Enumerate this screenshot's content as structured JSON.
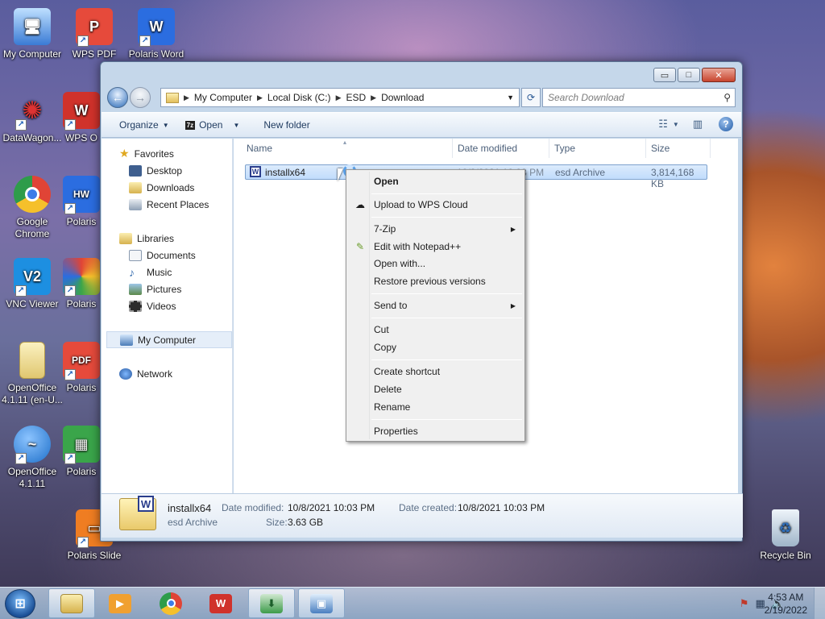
{
  "desktop_icons": [
    {
      "label": "My Computer",
      "icon": "computer-icon",
      "color": "#3a7bd5"
    },
    {
      "label": "WPS PDF",
      "icon": "wps-pdf-icon",
      "color": "#e64a3b"
    },
    {
      "label": "Polaris Word",
      "icon": "polaris-word-icon",
      "color": "#2b6de0"
    },
    {
      "label": "DataWagon...",
      "icon": "datawagon-icon",
      "color": "#c9382e"
    },
    {
      "label": "WPS O",
      "icon": "wps-office-icon",
      "color": "#d0322b"
    },
    {
      "label": "Google Chrome",
      "icon": "chrome-icon",
      "color": "#2e9c4a"
    },
    {
      "label": "Polaris",
      "icon": "polaris-hw-icon",
      "color": "#2b6de0"
    },
    {
      "label": "VNC Viewer",
      "icon": "vnc-icon",
      "color": "#1d8fe1"
    },
    {
      "label": "Polaris",
      "icon": "polaris-icon",
      "color": "#e48b24"
    },
    {
      "label": "OpenOffice 4.1.11 (en-U...",
      "icon": "openoffice-folder-icon",
      "color": "#e8d482"
    },
    {
      "label": "Polaris",
      "icon": "polaris-pdf-icon",
      "color": "#e64a3b"
    },
    {
      "label": "OpenOffice 4.1.11",
      "icon": "openoffice-icon",
      "color": "#1e6fc9"
    },
    {
      "label": "Polaris",
      "icon": "polaris-sheet-icon",
      "color": "#3aa54a"
    },
    {
      "label": "Polaris Slide",
      "icon": "polaris-slide-icon",
      "color": "#ef7d22"
    },
    {
      "label": "Recycle Bin",
      "icon": "recycle-bin-icon",
      "color": "#9fb5c9"
    }
  ],
  "window": {
    "controls": {
      "minimize": "▭",
      "maximize": "□",
      "close": "✕"
    },
    "address": {
      "crumbs": [
        "My Computer",
        "Local Disk (C:)",
        "ESD",
        "Download"
      ]
    },
    "search": {
      "placeholder": "Search Download"
    },
    "toolbar": {
      "organize": "Organize",
      "open": "Open",
      "open_badge": "7z",
      "new_folder": "New folder"
    },
    "nav": {
      "favorites": "Favorites",
      "favorites_items": [
        "Desktop",
        "Downloads",
        "Recent Places"
      ],
      "libraries": "Libraries",
      "libraries_items": [
        "Documents",
        "Music",
        "Pictures",
        "Videos"
      ],
      "computer": "My Computer",
      "network": "Network"
    },
    "columns": [
      "Name",
      "Date modified",
      "Type",
      "Size"
    ],
    "file": {
      "name": "installx64",
      "date_modified": "10/8/2021 10:03 PM",
      "type": "esd Archive",
      "size": "3,814,168 KB"
    },
    "details": {
      "name": "installx64",
      "type": "esd Archive",
      "date_modified_label": "Date modified:",
      "date_modified": "10/8/2021 10:03 PM",
      "date_created_label": "Date created:",
      "date_created": "10/8/2021 10:03 PM",
      "size_label": "Size:",
      "size": "3.63 GB"
    }
  },
  "context_menu": {
    "open": "Open",
    "upload": "Upload to WPS Cloud",
    "zip": "7-Zip",
    "notepad": "Edit with Notepad++",
    "open_with": "Open with...",
    "restore": "Restore previous versions",
    "send_to": "Send to",
    "cut": "Cut",
    "copy": "Copy",
    "create_shortcut": "Create shortcut",
    "delete": "Delete",
    "rename": "Rename",
    "properties": "Properties"
  },
  "taskbar": {
    "time": "4:53 AM",
    "date": "2/19/2022"
  }
}
